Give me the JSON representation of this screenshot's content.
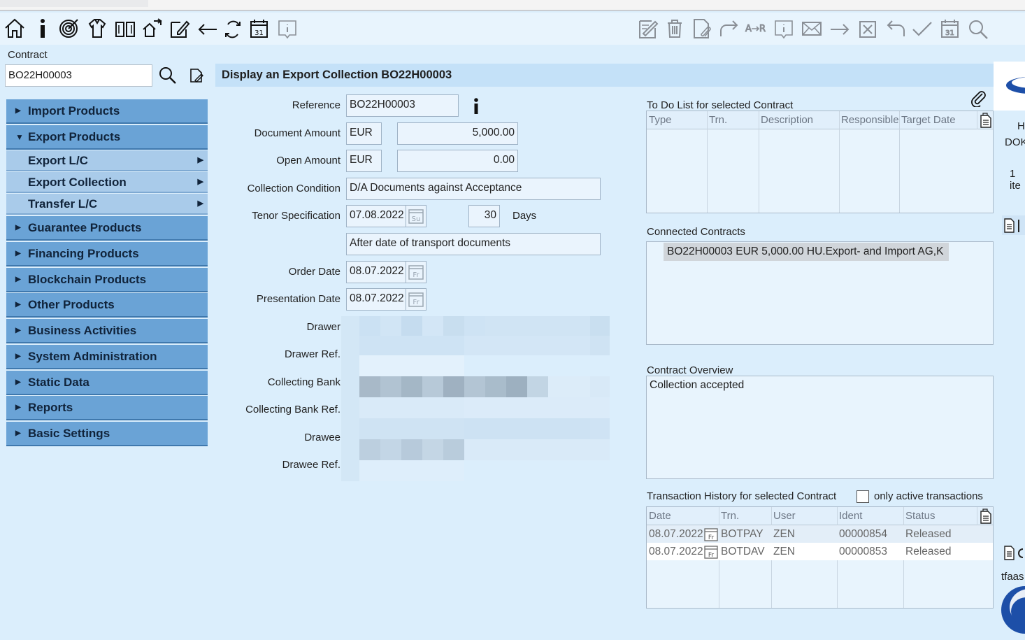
{
  "sidebar": {
    "contract_label": "Contract",
    "contract_value": "BO22H00003",
    "nav": [
      {
        "label": "Import Products"
      },
      {
        "label": "Export Products"
      },
      {
        "label": "Export L/C"
      },
      {
        "label": "Export Collection"
      },
      {
        "label": "Transfer L/C"
      },
      {
        "label": "Guarantee Products"
      },
      {
        "label": "Financing Products"
      },
      {
        "label": "Blockchain Products"
      },
      {
        "label": "Other Products"
      },
      {
        "label": "Business Activities"
      },
      {
        "label": "System Administration"
      },
      {
        "label": "Static Data"
      },
      {
        "label": "Reports"
      },
      {
        "label": "Basic Settings"
      }
    ]
  },
  "header": {
    "title": "Display an Export Collection BO22H00003"
  },
  "form": {
    "reference_label": "Reference",
    "reference_value": "BO22H00003",
    "doc_amount_label": "Document Amount",
    "doc_amount_currency": "EUR",
    "doc_amount_value": "5,000.00",
    "open_amount_label": "Open Amount",
    "open_amount_currency": "EUR",
    "open_amount_value": "0.00",
    "collection_condition_label": "Collection Condition",
    "collection_condition_value": "D/A   Documents against Acceptance",
    "tenor_label": "Tenor Specification",
    "tenor_date": "07.08.2022",
    "tenor_days": "30",
    "tenor_days_unit": "Days",
    "tenor_text": "After date of transport documents",
    "order_date_label": "Order Date",
    "order_date_value": "08.07.2022",
    "presentation_date_label": "Presentation Date",
    "presentation_date_value": "08.07.2022",
    "drawer_label": "Drawer",
    "drawer_ref_label": "Drawer Ref.",
    "collecting_bank_label": "Collecting Bank",
    "collecting_bank_ref_label": "Collecting Bank Ref.",
    "drawee_label": "Drawee",
    "drawee_ref_label": "Drawee Ref."
  },
  "todo": {
    "title": "To Do List for selected Contract",
    "columns": [
      "Type",
      "Trn.",
      "Description",
      "Responsible",
      "Target Date"
    ]
  },
  "connected": {
    "title": "Connected Contracts",
    "items": [
      "BO22H00003 EUR 5,000.00 HU.Export- and Import AG,K"
    ]
  },
  "overview": {
    "title": "Contract Overview",
    "text": "Collection accepted"
  },
  "history": {
    "title": "Transaction History for selected Contract",
    "only_active_label": "only active transactions",
    "columns": [
      "Date",
      "Trn.",
      "User",
      "Ident",
      "Status"
    ],
    "rows": [
      {
        "date": "08.07.2022",
        "trn": "BOTPAY",
        "user": "ZEN",
        "ident": "00000854",
        "status": "Released"
      },
      {
        "date": "08.07.2022",
        "trn": "BOTDAV",
        "user": "ZEN",
        "ident": "00000853",
        "status": "Released"
      }
    ]
  },
  "right_edge": {
    "t1": "H",
    "t2": "DOK",
    "t3": "1 ite",
    "t4": "tfaas"
  },
  "colors": {
    "nav_item": "#6aa3d6",
    "nav_sub": "#a9cbea",
    "background": "#dbeefc",
    "header_bar": "#c4e1f8"
  },
  "icons": {
    "left_toolbar": [
      "home-icon",
      "info-icon",
      "target-icon",
      "shirt-icon",
      "book-icon",
      "share-house-icon",
      "edit-icon",
      "back-arrow-icon",
      "refresh-icon",
      "calendar-icon",
      "info-box-icon"
    ],
    "right_toolbar": [
      "edit-doc-icon",
      "trash-icon",
      "attach-doc-icon",
      "redo-icon",
      "swap-icon",
      "info-box-icon",
      "mail-icon",
      "forward-arrow-icon",
      "cancel-box-icon",
      "undo-icon",
      "check-icon",
      "calendar-icon",
      "search-icon"
    ]
  }
}
